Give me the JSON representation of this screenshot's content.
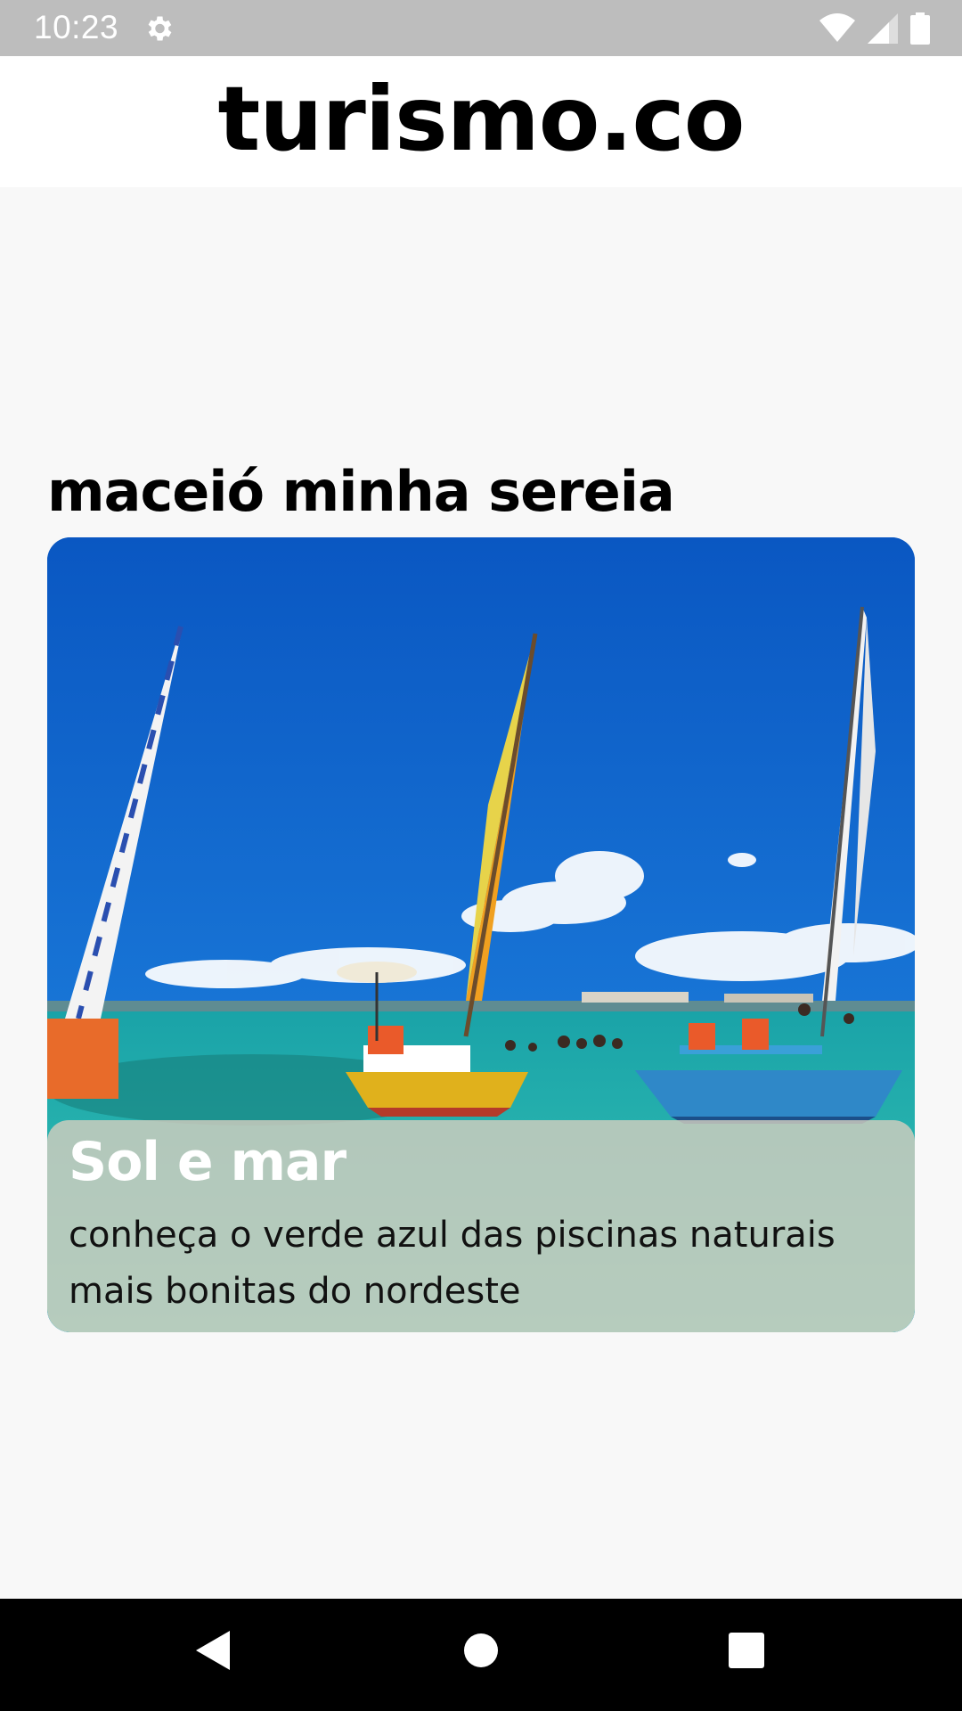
{
  "status_bar": {
    "time": "10:23",
    "icons": [
      "gear-icon",
      "wifi-icon",
      "signal-icon",
      "battery-icon"
    ]
  },
  "app": {
    "title": "turismo.co"
  },
  "section": {
    "title": "maceió minha sereia"
  },
  "card": {
    "image": "sailboats-beach-photo",
    "title": "Sol e mar",
    "description": "conheça o verde azul das piscinas naturais mais bonitas do nordeste"
  },
  "nav_bar": {
    "buttons": [
      "back-icon",
      "home-icon",
      "recents-icon"
    ]
  },
  "colors": {
    "status_bar": "#bdbdbd",
    "background": "#f8f8f8",
    "nav_bar": "#000000"
  }
}
